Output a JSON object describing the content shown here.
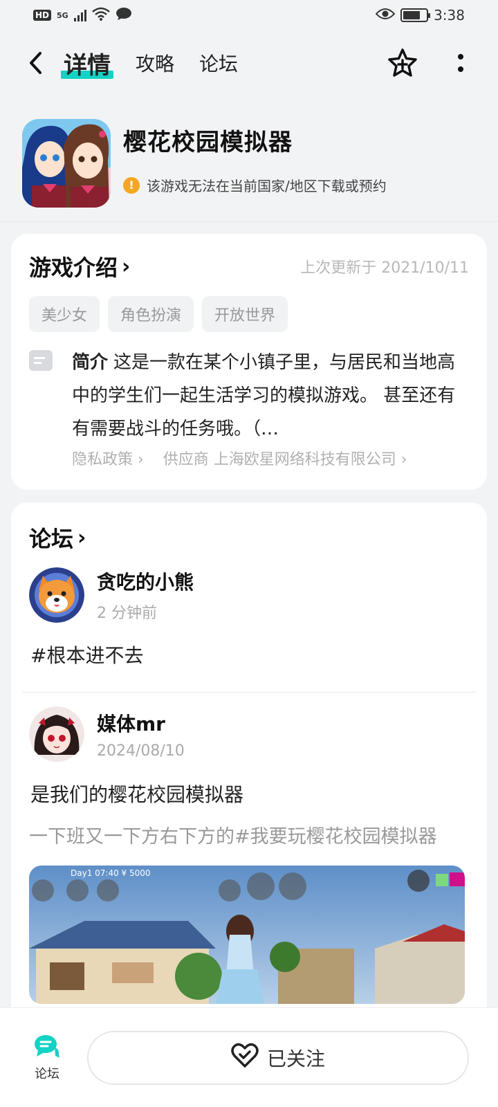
{
  "status_bar": {
    "hd": "HD",
    "network": "5G",
    "time": "3:38"
  },
  "nav": {
    "tabs": [
      {
        "label": "详情",
        "active": true
      },
      {
        "label": "攻略",
        "active": false
      },
      {
        "label": "论坛",
        "active": false
      }
    ],
    "icons": [
      "back-icon",
      "star-add-icon",
      "more-icon"
    ]
  },
  "app": {
    "title": "樱花校园模拟器",
    "warning": "该游戏无法在当前国家/地区下载或预约"
  },
  "intro": {
    "title": "游戏介绍",
    "updated": "上次更新于 2021/10/11",
    "tags": [
      "美少女",
      "角色扮演",
      "开放世界"
    ],
    "desc_label": "简介",
    "desc": "这是一款在某个小镇子里，与居民和当地高中的学生们一起生活学习的模拟游戏。 甚至还有有需要战斗的任务哦。（…",
    "privacy_link": "隐私政策 ›",
    "vendor_link": "供应商 上海欧星网络科技有限公司 ›"
  },
  "forum": {
    "title": "论坛",
    "posts": [
      {
        "username": "贪吃的小熊",
        "time": "2 分钟前",
        "body": "#根本进不去",
        "sub": ""
      },
      {
        "username": "媒体mr",
        "time": "2024/08/10",
        "body": "是我们的樱花校园模拟器",
        "sub": "一下班又一下方右下方的#我要玩樱花校园模拟器"
      }
    ],
    "game_hud": "Day1 07:40 ¥ 5000"
  },
  "bottom": {
    "forum_label": "论坛",
    "follow_label": "已关注"
  },
  "colors": {
    "accent": "#14d2c4",
    "warning": "#f5a623",
    "background": "#f2f3f5"
  }
}
